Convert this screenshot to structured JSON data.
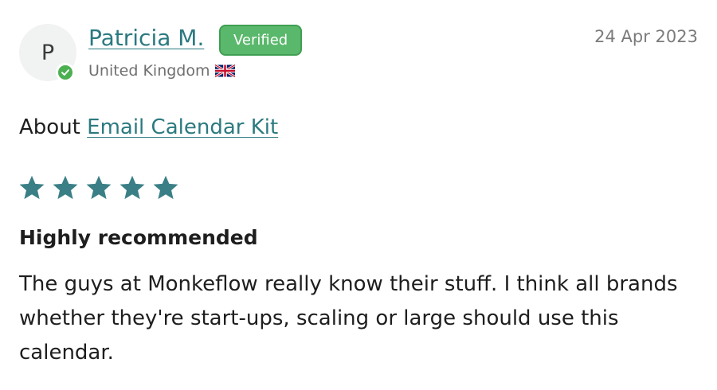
{
  "reviewer": {
    "initial": "P",
    "name": "Patricia M.",
    "verified_label": "Verified",
    "country": "United Kingdom",
    "flag_icon": "uk-flag-icon"
  },
  "date": "24 Apr 2023",
  "about": {
    "prefix": "About",
    "product": "Email Calendar Kit"
  },
  "rating": {
    "value": 5,
    "max": 5
  },
  "review": {
    "title": "Highly recommended",
    "body": "The guys at Monkeflow really know their stuff. I think all brands whether they're start-ups, scaling or large should use this calendar."
  },
  "colors": {
    "accent": "#2b7a80",
    "star": "#3a7f86",
    "verified_green": "#59b86b"
  }
}
